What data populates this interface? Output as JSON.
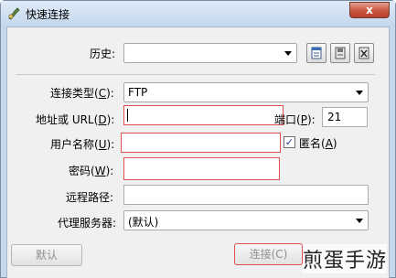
{
  "window": {
    "title": "快速连接",
    "close_glyph": "x",
    "accent": "#c5d8ec"
  },
  "form": {
    "history_label": "历史:",
    "history_value": "",
    "connection_type_label": "连接类型(",
    "connection_type_key": "C",
    "connection_type_close": "):",
    "connection_type_value": "FTP",
    "address_label": "地址或 URL(",
    "address_key": "D",
    "address_close": "):",
    "address_value": "",
    "port_label": "端口(",
    "port_key": "P",
    "port_close": "):",
    "port_value": "21",
    "username_label": "用户名称(",
    "username_key": "U",
    "username_close": "):",
    "username_value": "",
    "anonymous_label": "匿名(",
    "anonymous_key": "A",
    "anonymous_close": ")",
    "anonymous_checked": true,
    "password_label": "密码(",
    "password_key": "W",
    "password_close": "):",
    "password_value": "",
    "remote_path_label": "远程路径:",
    "remote_path_value": "",
    "proxy_label": "代理服务器:",
    "proxy_value": "(默认)"
  },
  "icons": {
    "app": "quick-connect-icon",
    "history_properties": "properties-icon",
    "history_save": "save-icon",
    "history_delete": "delete-icon"
  },
  "buttons": {
    "default_label": "默认",
    "connect_label": "连接(C)"
  },
  "watermark": "煎蛋手游",
  "highlight_color": "#e05050"
}
